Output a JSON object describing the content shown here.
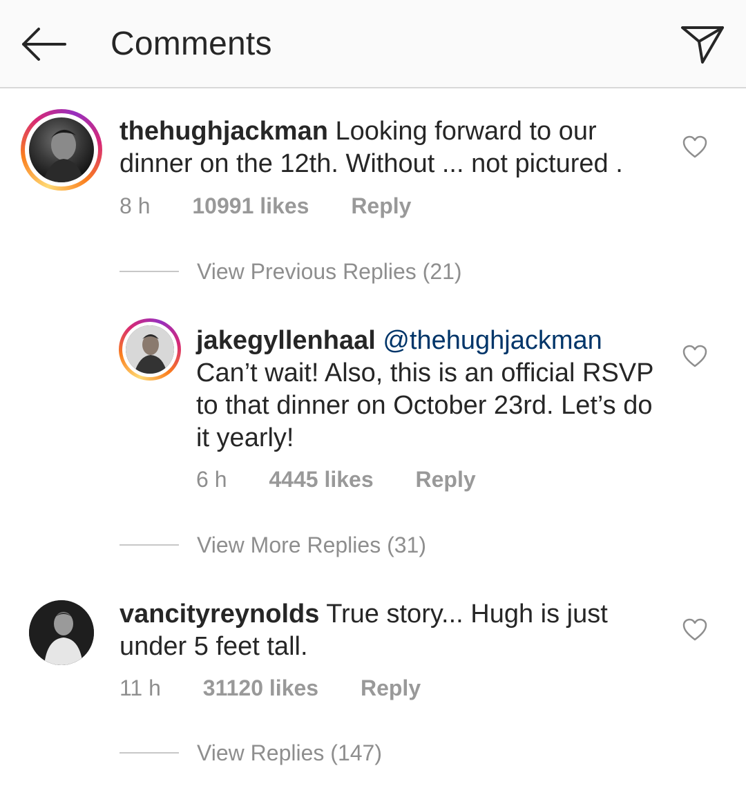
{
  "header": {
    "back_icon": "arrow-left-icon",
    "title": "Comments",
    "send_icon": "paper-plane-icon"
  },
  "comments": [
    {
      "username": "thehughjackman",
      "text": " Looking forward to our dinner on the 12th. Without ... not pictured .",
      "time": "8 h",
      "likes": "10991 likes",
      "reply": "Reply",
      "story_ring": true
    },
    {
      "username": "jakegyllenhaal",
      "mention": "@thehughjackman",
      "text": "Can’t wait! Also, this is an official RSVP to that dinner on October 23rd. Let’s do it yearly!",
      "time": "6 h",
      "likes": "4445 likes",
      "reply": "Reply",
      "story_ring": true
    },
    {
      "username": "vancityreynolds",
      "text": " True story... Hugh is just under 5 feet tall.",
      "time": "11 h",
      "likes": "31120 likes",
      "reply": "Reply",
      "story_ring": false
    }
  ],
  "thread_links": {
    "previous": "View Previous Replies (21)",
    "more": "View More Replies (31)",
    "replies": "View Replies (147)"
  },
  "colors": {
    "text": "#262626",
    "meta": "#8e8e8e",
    "mention": "#003569",
    "header_bg": "#fafafa"
  }
}
